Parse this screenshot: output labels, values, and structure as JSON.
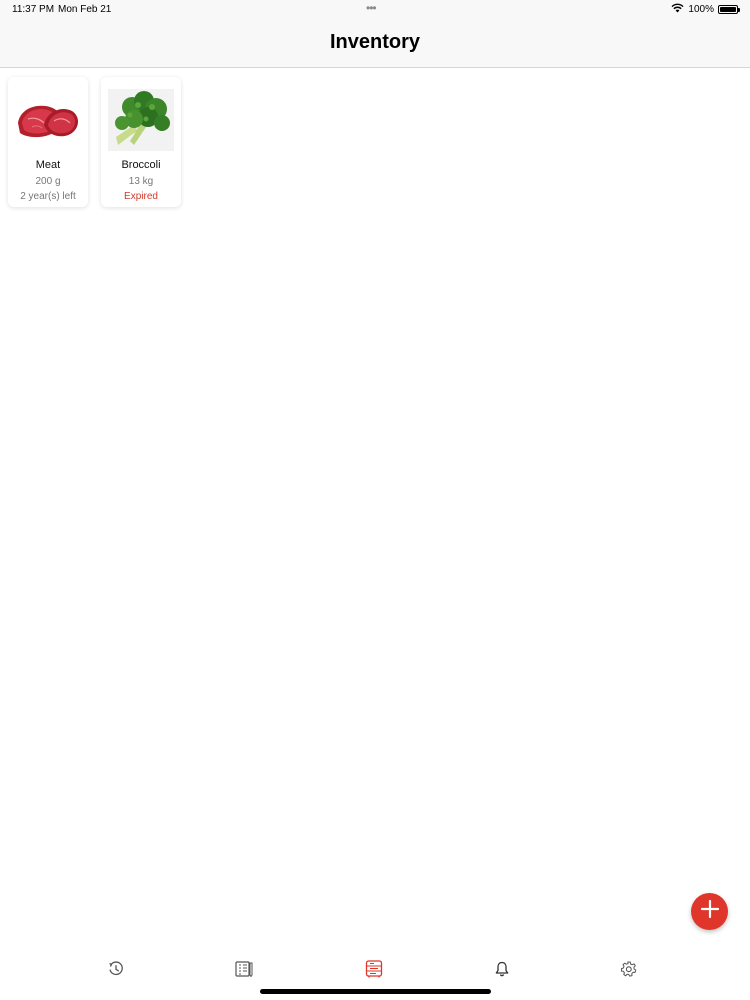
{
  "status_bar": {
    "time": "11:37 PM",
    "date": "Mon Feb 21",
    "battery_text": "100%",
    "battery_level": 1.0,
    "icons": [
      "multitasking-dots-icon",
      "wifi-icon",
      "battery-icon"
    ]
  },
  "nav": {
    "title": "Inventory"
  },
  "items": [
    {
      "name": "Meat",
      "quantity": "200 g",
      "status": "2 year(s) left",
      "expired": false,
      "image": "meat-image"
    },
    {
      "name": "Broccoli",
      "quantity": "13 kg",
      "status": "Expired",
      "expired": true,
      "image": "broccoli-image"
    }
  ],
  "colors": {
    "accent": "#e0352a",
    "expired": "#d23a2c",
    "secondary_text": "#777777",
    "bar_background": "#f8f8f9"
  },
  "fab": {
    "icon": "plus-icon"
  },
  "tab_bar": {
    "tabs": [
      {
        "icon": "history-icon",
        "selected": false
      },
      {
        "icon": "recipe-book-icon",
        "selected": false
      },
      {
        "icon": "fridge-inventory-icon",
        "selected": true
      },
      {
        "icon": "bell-icon",
        "selected": false
      },
      {
        "icon": "gear-icon",
        "selected": false
      }
    ]
  }
}
